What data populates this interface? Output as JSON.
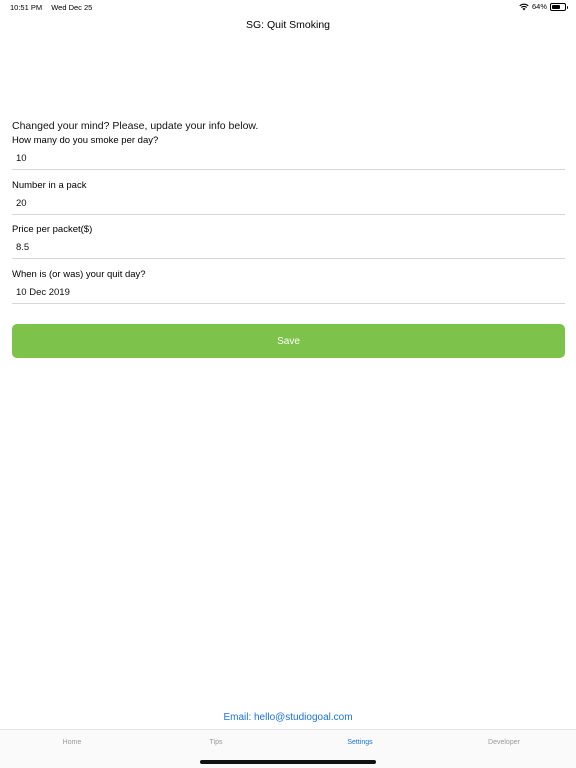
{
  "status_bar": {
    "time": "10:51 PM",
    "date": "Wed Dec 25",
    "battery_percent": "64%",
    "battery_level": 0.64,
    "wifi_icon": "wifi-icon",
    "battery_icon": "battery-icon"
  },
  "nav": {
    "title": "SG: Quit Smoking"
  },
  "form": {
    "intro": "Changed your mind? Please, update your info below.",
    "fields": [
      {
        "label": "How many do you smoke per day?",
        "value": "10"
      },
      {
        "label": "Number in a pack",
        "value": "20"
      },
      {
        "label": "Price per packet($)",
        "value": "8.5"
      },
      {
        "label": "When is (or was) your quit day?",
        "value": "10 Dec 2019"
      }
    ],
    "save_label": "Save"
  },
  "footer": {
    "email": "Email: hello@studiogoal.com"
  },
  "tabs": [
    {
      "label": "Home"
    },
    {
      "label": "Tips"
    },
    {
      "label": "Settings"
    },
    {
      "label": "Developer"
    }
  ],
  "colors": {
    "accent": "#1a73d8",
    "save_button": "#7dc24b"
  }
}
